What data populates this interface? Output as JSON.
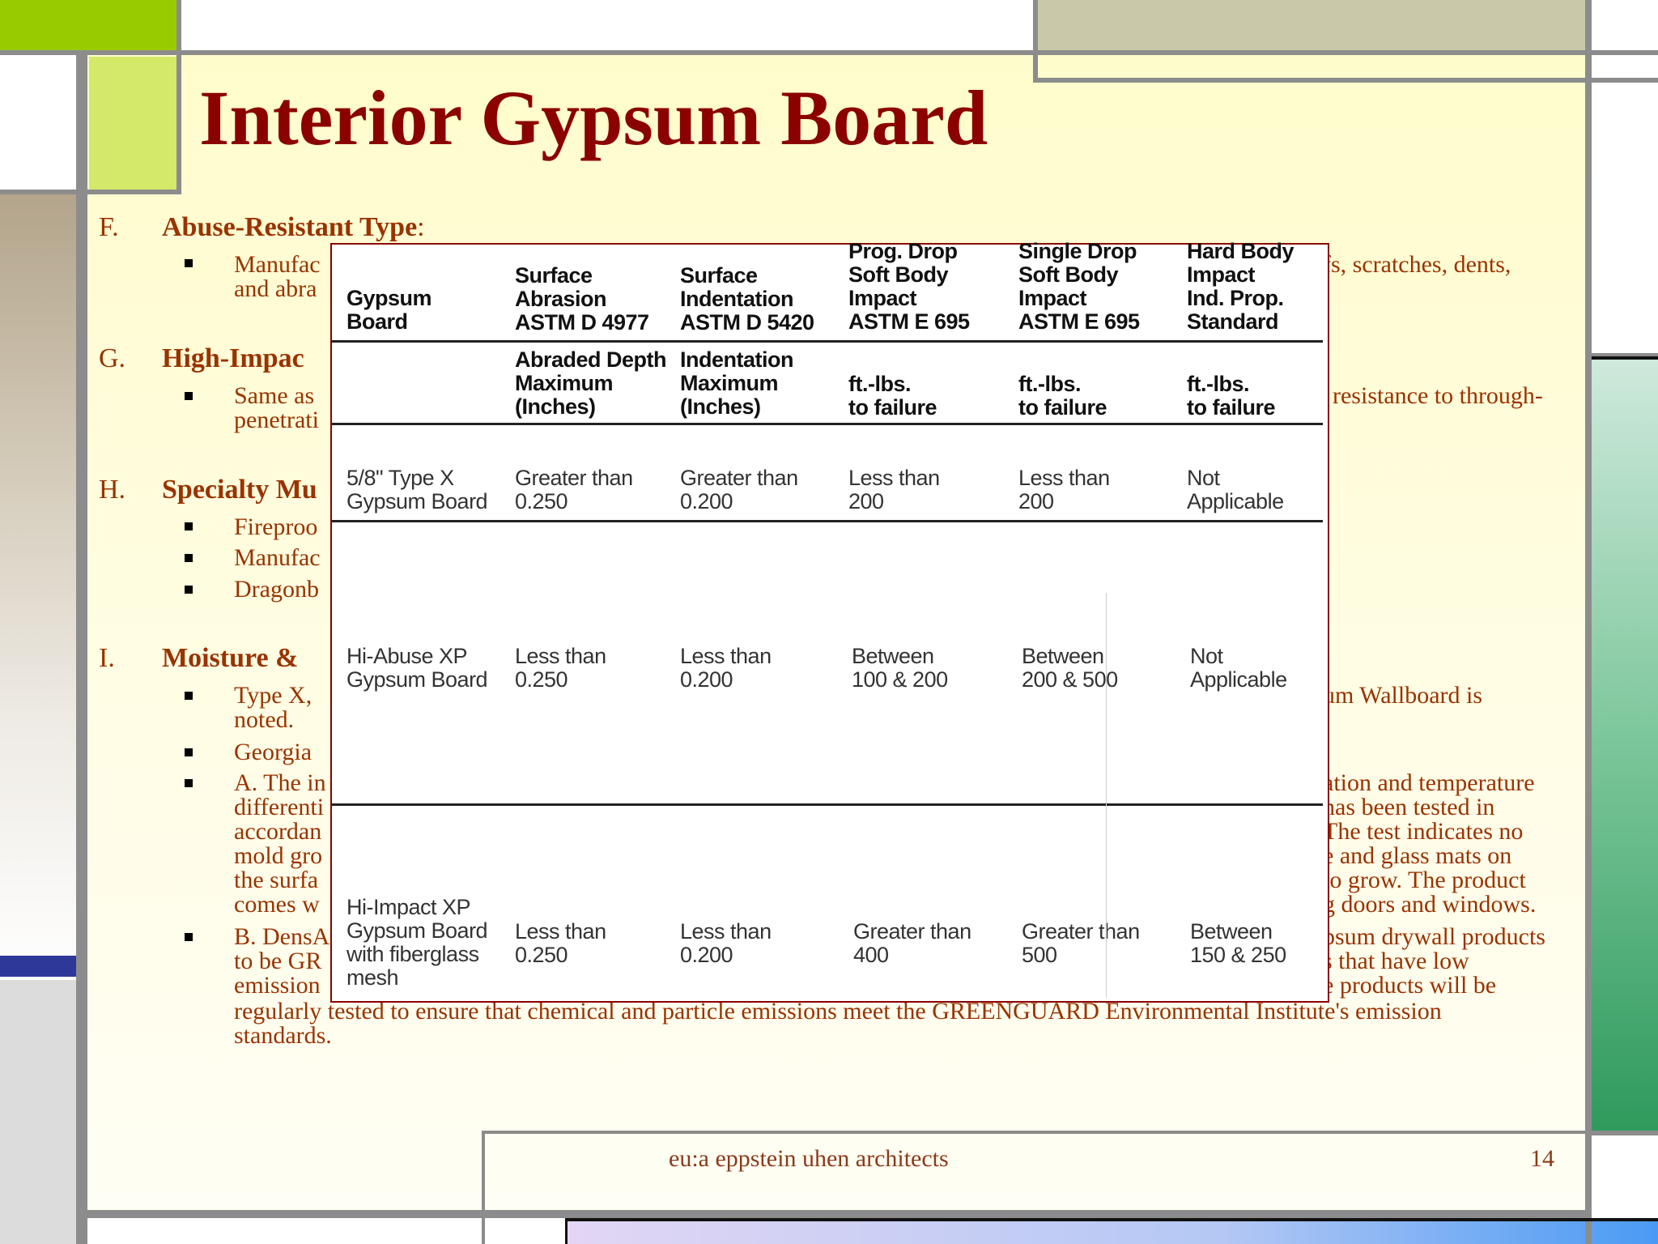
{
  "slide": {
    "title": "Interior Gypsum Board",
    "page_number": "14"
  },
  "footer": {
    "text": "eu:a   eppstein uhen architects"
  },
  "sections": [
    {
      "letter": "F.",
      "title": "Abuse-Resistant Type",
      "title_suffix": ":",
      "bullets": [
        {
          "left": "Manufac",
          "right": "fs, scratches, dents,",
          "line2_left": "and abra"
        }
      ]
    },
    {
      "letter": "G.",
      "title": "High-Impac",
      "bullets": [
        {
          "left": "Same as ",
          "right": "resistance to through-",
          "line2_left": "penetrati"
        }
      ]
    },
    {
      "letter": "H.",
      "title": "Specialty Mu",
      "bullets": [
        {
          "left": "Fireproo"
        },
        {
          "left": "Manufac"
        },
        {
          "left": "Dragonb"
        }
      ]
    },
    {
      "letter": "I.",
      "title": "Moisture & ",
      "bullets": [
        {
          "left": "Type X, ",
          "right": "um Wallboard is",
          "line2_left": "noted."
        },
        {
          "left": "Georgia "
        },
        {
          "left": "A. The in",
          "right": "ation and temperature",
          "lines_left": [
            "differenti",
            "accordan",
            "mold gro",
            "the surfa",
            "comes w"
          ],
          "lines_right": [
            "has been tested in",
            "The test indicates no",
            "e and glass mats on",
            "to grow.  The product",
            "g doors and windows."
          ]
        },
        {
          "left": "B. DensA",
          "right": "psum drywall products",
          "lines_left": [
            "to be GR",
            "emission"
          ],
          "lines_right": [
            "s that have low",
            "e products will be"
          ],
          "full_lines": [
            "regularly tested to ensure that chemical and particle emissions meet the GREENGUARD Environmental Institute's emission",
            "standards."
          ]
        }
      ]
    }
  ],
  "table": {
    "header_row1": [
      "Gypsum\nBoard",
      "Surface\nAbrasion\nASTM D 4977",
      "Surface\nIndentation\nASTM D 5420",
      "Prog. Drop\nSoft Body\nImpact\nASTM E 695",
      "Single Drop\nSoft Body\nImpact\nASTM E 695",
      "Hard Body\nImpact\nInd. Prop.\nStandard"
    ],
    "header_row2": [
      "",
      "Abraded Depth\nMaximum\n(Inches)",
      "Indentation\nMaximum\n(Inches)",
      "ft.-lbs.\nto failure",
      "ft.-lbs.\nto failure",
      "ft.-lbs.\nto failure"
    ],
    "rows": [
      [
        "5/8\" Type X\nGypsum Board",
        "Greater than\n0.250",
        "Greater than\n0.200",
        "Less than\n200",
        "Less than\n200",
        "Not\nApplicable"
      ],
      [
        "Hi-Abuse XP\nGypsum Board",
        "Less than\n0.250",
        "Less than\n0.200",
        "Between\n100 & 200",
        "Between\n200 & 500",
        "Not\nApplicable"
      ],
      [
        "Hi-Impact XP\nGypsum Board\nwith fiberglass\nmesh",
        "Less than\n0.250",
        "Less than\n0.200",
        "Greater than\n400",
        "Greater than\n500",
        "Between\n150 & 250"
      ]
    ]
  },
  "colors": {
    "title": "#8b0000",
    "body_text": "#993300",
    "accent_green": "#99cc00",
    "frame_grey": "#8c8c8c"
  }
}
